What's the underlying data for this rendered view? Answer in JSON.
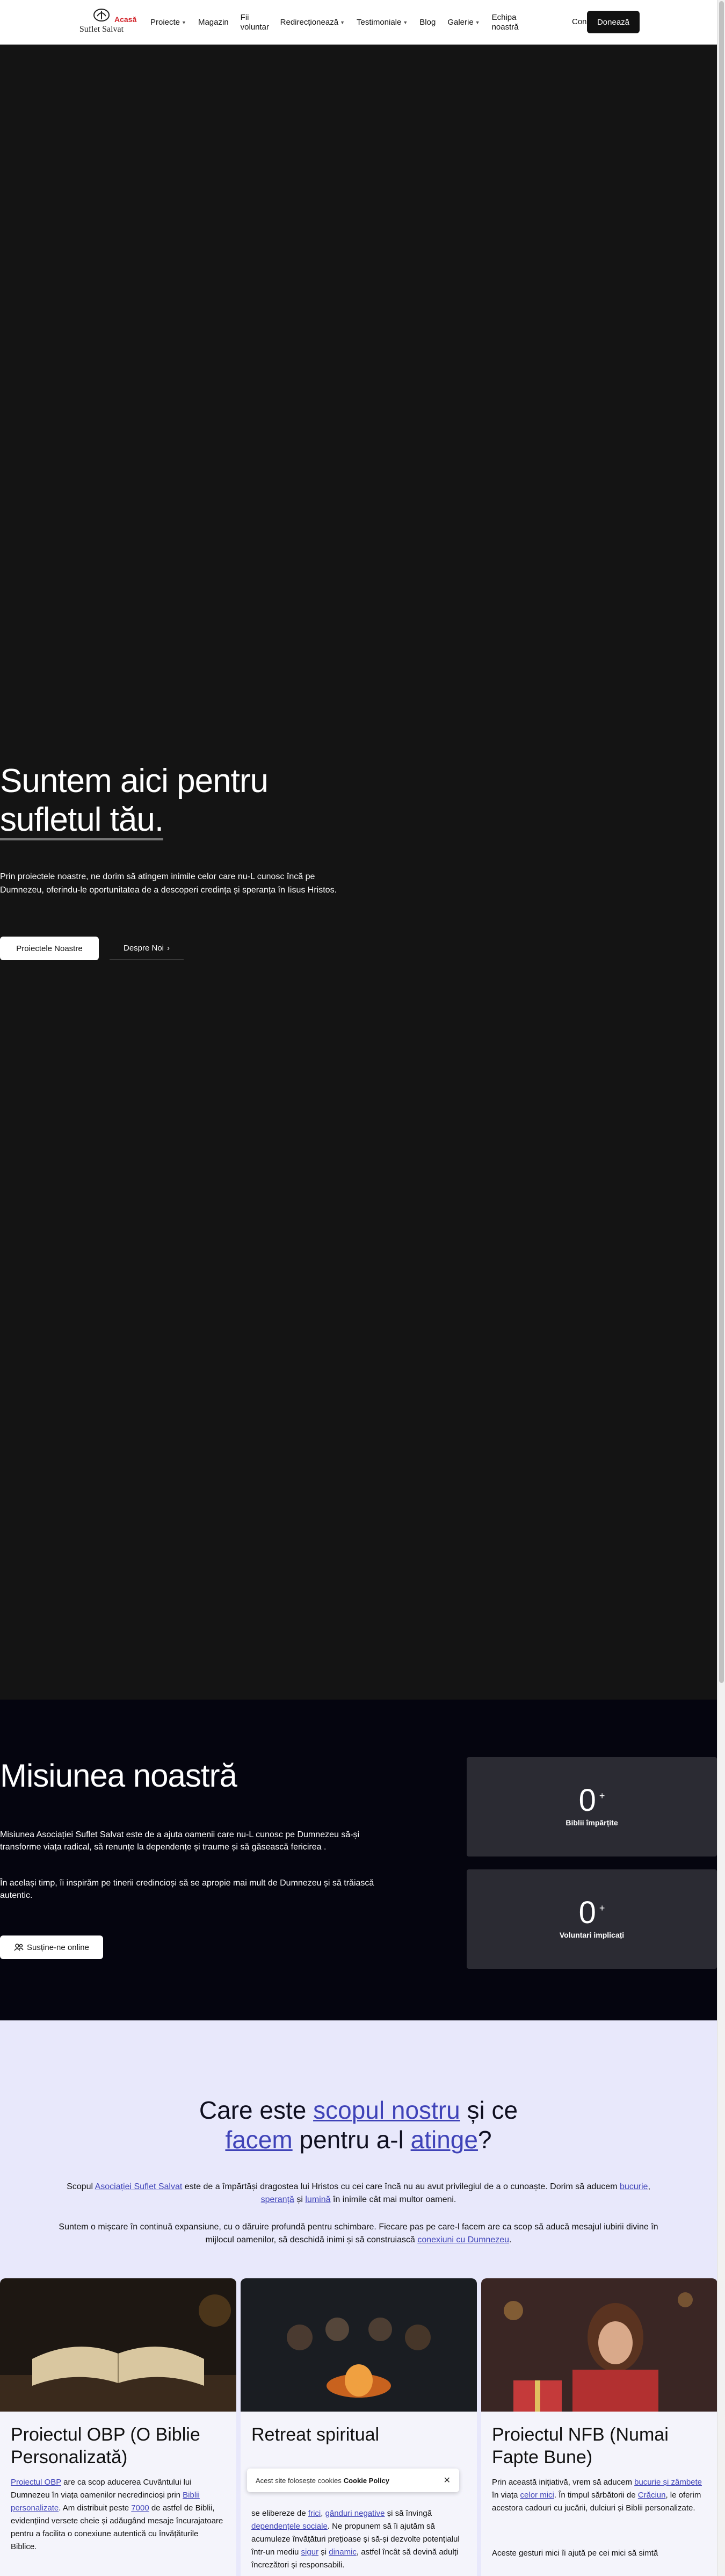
{
  "header": {
    "brand": "Suflet Salvat",
    "home_label": "Acasă",
    "nav": [
      {
        "label": "Proiecte",
        "dropdown": true
      },
      {
        "label": "Magazin",
        "dropdown": false
      },
      {
        "label": "Fii voluntar",
        "dropdown": false
      },
      {
        "label": "Redirecționează",
        "dropdown": true
      },
      {
        "label": "Testimoniale",
        "dropdown": true
      },
      {
        "label": "Blog",
        "dropdown": false
      },
      {
        "label": "Galerie",
        "dropdown": true
      },
      {
        "label": "Echipa noastră",
        "dropdown": false
      }
    ],
    "contact_clip": "Con",
    "donate_label": "Donează"
  },
  "hero": {
    "title_line1": "Suntem aici pentru",
    "title_line2": "sufletul tău.",
    "text": "Prin proiectele noastre, ne dorim să atingem inimile celor care nu-L cunosc încă pe Dumnezeu, oferindu-le oportunitatea de a descoperi credința și speranța în Iisus Hristos.",
    "primary_button": "Proiectele Noastre",
    "secondary_button": "Despre Noi"
  },
  "mission": {
    "title": "Misiunea noastră",
    "p1": "Misiunea Asociației Suflet Salvat este de a ajuta oamenii care nu-L cunosc pe Dumnezeu să-și transforme viața radical, să renunțe la dependențe și traume și să găsească fericirea .",
    "p2": "În același timp, îi inspirăm pe tinerii credincioși să se apropie mai mult de Dumnezeu și să trăiască autentic.",
    "button": "Susține-ne online",
    "stats": [
      {
        "value": "0",
        "suffix": "+",
        "label": "Biblii împărțite"
      },
      {
        "value": "0",
        "suffix": "+",
        "label": "Voluntari implicați"
      }
    ]
  },
  "purpose": {
    "title": {
      "t1": "Care este ",
      "h1": "scopul nostru",
      "t2": " și ce",
      "h2": "facem",
      "t3": " pentru a-l ",
      "h3": "atinge",
      "t4": "?"
    },
    "p1": {
      "a": "Scopul ",
      "l1": "Asociației Suflet Salvat",
      "b": " este de a împărtăși dragostea lui Hristos cu cei care încă nu au avut privilegiul de a o cunoaște. Dorim să aducem ",
      "l2": "bucurie",
      "c": ", ",
      "l3": "speranță",
      "d": " și ",
      "l4": "lumină",
      "e": " în inimile cât mai multor oameni."
    },
    "p2": {
      "a": "Suntem o mișcare în continuă expansiune, cu o dăruire profundă pentru schimbare. Fiecare pas pe care-l facem are ca scop să aducă mesajul iubirii divine în mijlocul oamenilor, să deschidă inimi și să construiască ",
      "l1": "conexiuni cu Dumnezeu",
      "b": "."
    },
    "cards": [
      {
        "title": "Proiectul OBP (O Biblie Personalizată)",
        "text": {
          "l1": "Proiectul OBP",
          "a": " are ca scop aducerea Cuvântului lui Dumnezeu în viața oamenilor necredincioși prin ",
          "l2": "Biblii personalizate",
          "b": ". Am distribuit peste ",
          "l3": "7000",
          "c": " de astfel de Biblii, evidențiind versete cheie și adăugând mesaje încurajatoare pentru a facilita o conexiune autentică cu învățăturile Biblice."
        }
      },
      {
        "title": "Retreat spiritual",
        "text": {
          "a": "se elibereze de ",
          "l1": "frici",
          "b": ", ",
          "l2": "gânduri negative",
          "c": " și să învingă ",
          "l3": "dependențele sociale",
          "d": ". Ne propunem să îi ajutăm să acumuleze învățături prețioase și să-și dezvolte potențialul într-un mediu ",
          "l4": "sigur",
          "e": " și ",
          "l5": "dinamic",
          "f": ", astfel încât să devină adulți încrezători și responsabili."
        }
      },
      {
        "title": "Proiectul NFB (Numai Fapte Bune)",
        "text": {
          "a": "Prin această inițiativă, vrem să aducem ",
          "l1": "bucurie și zâmbete",
          "b": " în viața ",
          "l2": "celor mici",
          "c": ". În timpul sărbătorii de ",
          "l3": "Crăciun",
          "d": ", le oferim acestora cadouri cu jucării, dulciuri și Biblii personalizate.",
          "e": "Aceste gesturi mici îi ajută pe cei mici să simtă"
        }
      }
    ]
  },
  "cookie": {
    "text": "Acest site folosește cookies",
    "policy": "Cookie Policy",
    "close": "✕"
  },
  "colors": {
    "accent": "#3f43b8",
    "hero_bg": "#141414",
    "mission_bg": "#05050f",
    "purpose_bg": "#e8e8fb",
    "home_red": "#d2232a"
  }
}
